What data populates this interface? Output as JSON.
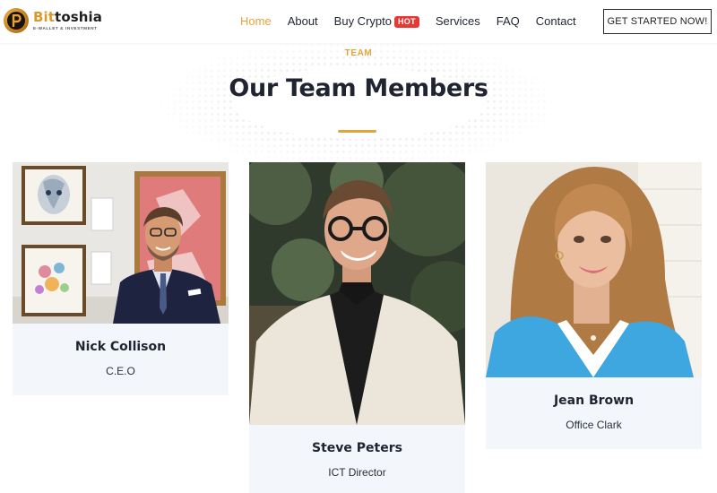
{
  "brand": {
    "name_first": "Bit",
    "name_rest": "toshia",
    "tagline": "E-WALLET & INVESTMENT"
  },
  "nav": {
    "items": [
      {
        "label": "Home",
        "active": true
      },
      {
        "label": "About"
      },
      {
        "label": "Buy Crypto",
        "badge": "HOT"
      },
      {
        "label": "Services"
      },
      {
        "label": "FAQ"
      },
      {
        "label": "Contact"
      }
    ],
    "cta_label": "GET STARTED NOW!"
  },
  "section": {
    "eyebrow": "TEAM",
    "title": "Our Team Members"
  },
  "team": [
    {
      "name": "Nick Collison",
      "role": "C.E.O"
    },
    {
      "name": "Steve Peters",
      "role": "ICT Director"
    },
    {
      "name": "Jean Brown",
      "role": "Office Clark"
    }
  ],
  "colors": {
    "accent": "#e9a23b",
    "hot_badge": "#e53935",
    "card_info_bg": "#f3f7fc",
    "text_dark": "#1f2430"
  },
  "icons": [
    "bittoshia-logo-icon"
  ]
}
